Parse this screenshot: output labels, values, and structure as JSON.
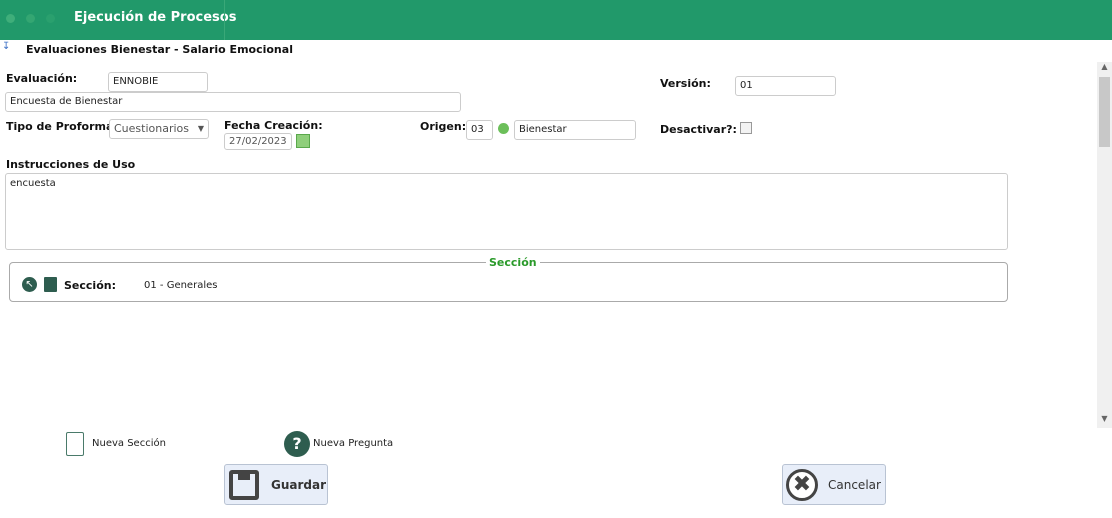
{
  "header": {
    "title": "Ejecución de Procesos"
  },
  "page": {
    "title": "Evaluaciones Bienestar - Salario Emocional"
  },
  "form": {
    "evaluacion_label": "Evaluación:",
    "evaluacion_code": "ENNOBIE",
    "evaluacion_desc": "Encuesta de Bienestar",
    "version_label": "Versión:",
    "version_value": "01",
    "tipo_label": "Tipo de Proforma:",
    "tipo_value": "Cuestionarios",
    "fecha_label": "Fecha Creación:",
    "fecha_value": "27/02/2023",
    "origen_label": "Origen:",
    "origen_code": "03",
    "origen_desc": "Bienestar",
    "desactivar_label": "Desactivar?:",
    "desactivar_checked": false,
    "instrucciones_label": "Instrucciones de Uso",
    "instrucciones_value": "encuesta"
  },
  "seccion": {
    "legend": "Sección",
    "label": "Sección:",
    "value": "01 - Generales"
  },
  "actions": {
    "nueva_seccion": "Nueva Sección",
    "nueva_pregunta": "Nueva Pregunta",
    "guardar": "Guardar",
    "cancelar": "Cancelar"
  },
  "colors": {
    "header": "#21996a",
    "legend": "#2a9a2a",
    "icon": "#2e5d4f"
  }
}
